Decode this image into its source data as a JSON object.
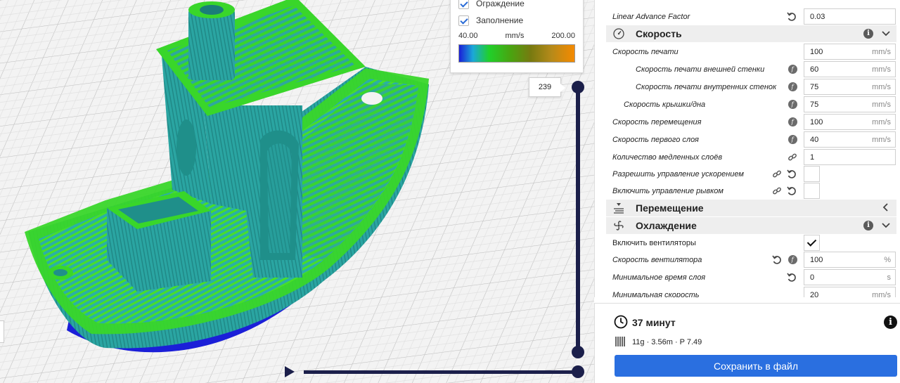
{
  "legend": {
    "items": [
      {
        "label": "Ограждение",
        "checked": true
      },
      {
        "label": "Заполнение",
        "checked": true
      }
    ],
    "min": "40.00",
    "unit": "mm/s",
    "max": "200.00"
  },
  "layer_slider": {
    "current_layer": "239"
  },
  "settings": {
    "top_row": {
      "label": "Linear Advance Factor",
      "value": "0.03"
    },
    "speed_section": {
      "title": "Скорость"
    },
    "speed_rows": [
      {
        "label": "Скорость печати",
        "value": "100",
        "unit": "mm/s"
      },
      {
        "label": "Скорость печати внешней стенки",
        "value": "60",
        "unit": "mm/s"
      },
      {
        "label": "Скорость печати внутренних стенок",
        "value": "75",
        "unit": "mm/s"
      },
      {
        "label": "Скорость крышки/дна",
        "value": "75",
        "unit": "mm/s"
      },
      {
        "label": "Скорость перемещения",
        "value": "100",
        "unit": "mm/s"
      },
      {
        "label": "Скорость первого слоя",
        "value": "40",
        "unit": "mm/s"
      },
      {
        "label": "Количество медленных слоёв",
        "value": "1",
        "unit": ""
      },
      {
        "label": "Разрешить управление ускорением",
        "checked": false
      },
      {
        "label": "Включить управление рывком",
        "checked": false
      }
    ],
    "travel_section": {
      "title": "Перемещение"
    },
    "cooling_section": {
      "title": "Охлаждение"
    },
    "cooling_rows": [
      {
        "label": "Включить вентиляторы",
        "checked": true
      },
      {
        "label": "Скорость вентилятора",
        "value": "100",
        "unit": "%"
      },
      {
        "label": "Минимальное время слоя",
        "value": "0",
        "unit": "s"
      },
      {
        "label": "Минимальная скорость",
        "value": "20",
        "unit": "mm/s"
      }
    ]
  },
  "action": {
    "print_time": "37 минут",
    "stats": "11g · 3.56m · P 7.49",
    "save_label": "Сохранить в файл"
  },
  "colors": {
    "accent": "#2a6fe0",
    "slider": "#1b1f4a",
    "shell": "#2bb3ab",
    "infill": "#39d62a",
    "first_layer": "#1b1fd8"
  }
}
